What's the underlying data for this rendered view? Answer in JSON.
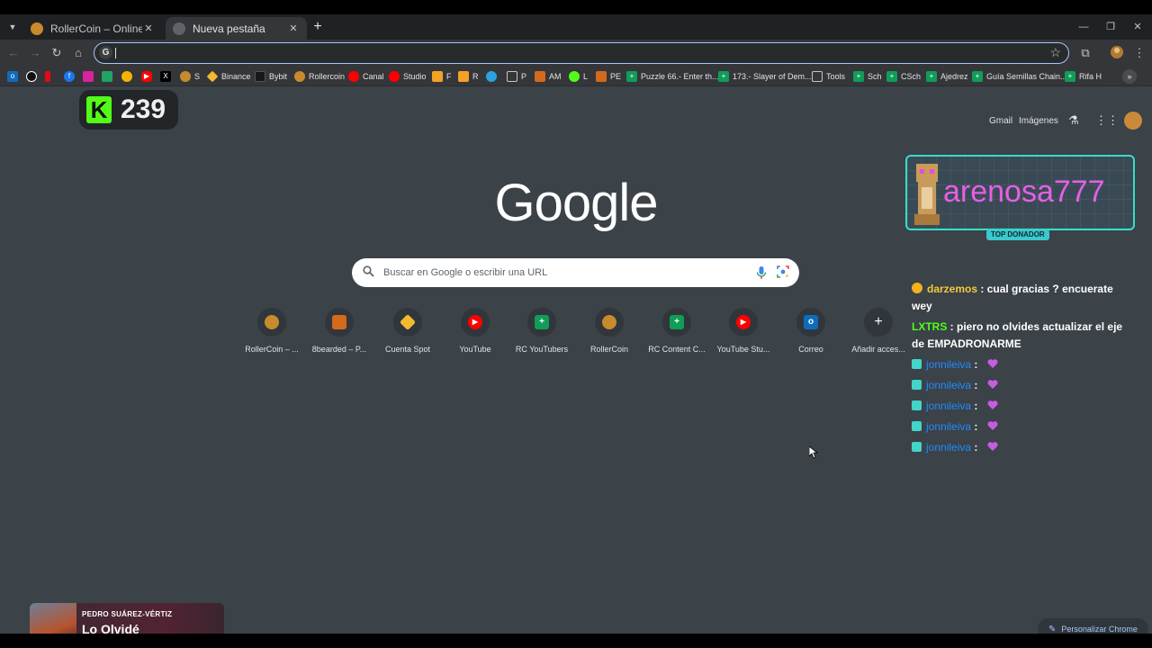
{
  "tabs": [
    {
      "title": "RollerCoin – Online Bitcoin Mining Simulator",
      "active": false
    },
    {
      "title": "Nueva pestaña",
      "active": true
    }
  ],
  "omnibox": {
    "value": "",
    "icon": "G"
  },
  "bookmarks": [
    {
      "label": "",
      "icon": "outlook",
      "color": "#0f6cbd"
    },
    {
      "label": "",
      "icon": "tiktok",
      "color": "#111111"
    },
    {
      "label": "",
      "icon": "netflix",
      "color": "#e50914"
    },
    {
      "label": "",
      "icon": "facebook",
      "color": "#1877f2"
    },
    {
      "label": "",
      "icon": "instagram",
      "color": "#d6249f"
    },
    {
      "label": "",
      "icon": "drive",
      "color": "#1fa463"
    },
    {
      "label": "",
      "icon": "photos",
      "color": "#f4b400"
    },
    {
      "label": "",
      "icon": "youtube",
      "color": "#ff0000"
    },
    {
      "label": "",
      "icon": "x",
      "color": "#000000"
    },
    {
      "label": "S",
      "icon": "rollercoin",
      "color": "#c78a2c"
    },
    {
      "label": "Binance",
      "icon": "binance",
      "color": "#f3ba2f"
    },
    {
      "label": "Bybit",
      "icon": "bybit",
      "color": "#17181e"
    },
    {
      "label": "Rollercoin",
      "icon": "rollercoin",
      "color": "#c78a2c"
    },
    {
      "label": "Canal",
      "icon": "youtube",
      "color": "#ff0000"
    },
    {
      "label": "Studio",
      "icon": "youtube",
      "color": "#ff0000"
    },
    {
      "label": "F",
      "icon": "bearded",
      "color": "#f4a225"
    },
    {
      "label": "R",
      "icon": "bearded",
      "color": "#f4a225"
    },
    {
      "label": "",
      "icon": "telegram",
      "color": "#2aa3df"
    },
    {
      "label": "P",
      "icon": "folder",
      "color": "#c4c7c5"
    },
    {
      "label": "AM",
      "icon": "bearded",
      "color": "#d46a1c"
    },
    {
      "label": "L",
      "icon": "kick",
      "color": "#53fc18"
    },
    {
      "label": "PE",
      "icon": "bearded",
      "color": "#d46a1c"
    },
    {
      "label": "Puzzle 66.- Enter th...",
      "icon": "sheets",
      "color": "#0f9d58"
    },
    {
      "label": "173.- Slayer of Dem...",
      "icon": "sheets",
      "color": "#0f9d58"
    },
    {
      "label": "Tools",
      "icon": "folder",
      "color": "#c4c7c5"
    },
    {
      "label": "Sch",
      "icon": "sheets",
      "color": "#0f9d58"
    },
    {
      "label": "CSch",
      "icon": "sheets",
      "color": "#0f9d58"
    },
    {
      "label": "Ajedrez",
      "icon": "sheets",
      "color": "#0f9d58"
    },
    {
      "label": "Guía Semillas Chain...",
      "icon": "sheets",
      "color": "#0f9d58"
    },
    {
      "label": "Rifa H",
      "icon": "sheets",
      "color": "#0f9d58"
    }
  ],
  "kick": {
    "count": "239"
  },
  "header_links": {
    "gmail": "Gmail",
    "images": "Imágenes"
  },
  "google_logo": "Google",
  "search": {
    "placeholder": "Buscar en Google o escribir una URL"
  },
  "shortcuts": [
    {
      "label": "RollerCoin – ...",
      "icon": "rollercoin",
      "color": "#c78a2c"
    },
    {
      "label": "8bearded – P...",
      "icon": "bearded",
      "color": "#d46a1c"
    },
    {
      "label": "Cuenta Spot",
      "icon": "binance",
      "color": "#f3ba2f"
    },
    {
      "label": "YouTube",
      "icon": "youtube",
      "color": "#ff0000"
    },
    {
      "label": "RC YouTubers",
      "icon": "sheets",
      "color": "#0f9d58"
    },
    {
      "label": "RollerCoin",
      "icon": "rollercoin",
      "color": "#c78a2c"
    },
    {
      "label": "RC Content C...",
      "icon": "sheets",
      "color": "#0f9d58"
    },
    {
      "label": "YouTube Stu...",
      "icon": "youtube",
      "color": "#ff0000"
    },
    {
      "label": "Correo",
      "icon": "outlook",
      "color": "#0f6cbd"
    },
    {
      "label": "Añadir acces...",
      "icon": "plus",
      "color": "#30363b"
    }
  ],
  "donor": {
    "name": "arenosa777",
    "tag": "TOP DONADOR"
  },
  "chat": [
    {
      "user": "darzemos",
      "message": "cual gracias ? encuerate wey",
      "badge": "coin",
      "color": "yellow"
    },
    {
      "user": "LXTRS",
      "message": "piero no olvides actualizar el eje de EMPADRONARME",
      "badge": "none",
      "color": "green"
    },
    {
      "user": "jonnileiva",
      "message": "",
      "badge": "sub",
      "color": "blue"
    },
    {
      "user": "jonnileiva",
      "message": "",
      "badge": "sub",
      "color": "blue"
    },
    {
      "user": "jonnileiva",
      "message": "",
      "badge": "sub",
      "color": "blue"
    },
    {
      "user": "jonnileiva",
      "message": "",
      "badge": "sub",
      "color": "blue"
    },
    {
      "user": "jonnileiva",
      "message": "",
      "badge": "sub",
      "color": "blue"
    }
  ],
  "now_playing": {
    "artist": "PEDRO SUÁREZ-VÉRTIZ",
    "title": "Lo Olvidé"
  },
  "customize": {
    "label": "Personalizar Chrome"
  }
}
